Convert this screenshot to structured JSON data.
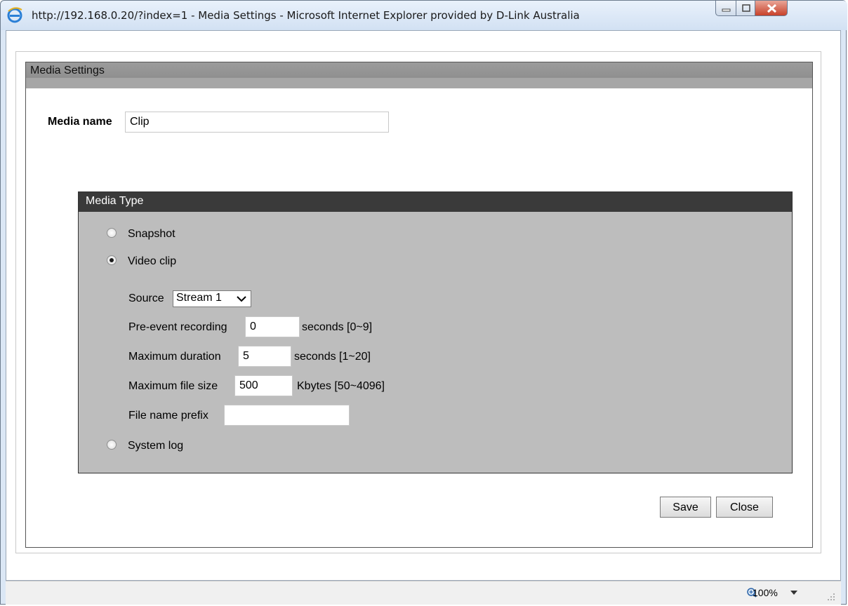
{
  "window": {
    "title": "http://192.168.0.20/?index=1 - Media Settings - Microsoft Internet Explorer provided by D-Link Australia"
  },
  "panel": {
    "title": "Media Settings"
  },
  "media_name": {
    "label": "Media name",
    "value": "Clip"
  },
  "media_type": {
    "title": "Media Type",
    "options": [
      {
        "label": "Snapshot",
        "selected": false
      },
      {
        "label": "Video clip",
        "selected": true
      },
      {
        "label": "System log",
        "selected": false
      }
    ],
    "source": {
      "label": "Source",
      "value": "Stream 1"
    },
    "pre_event": {
      "label": "Pre-event recording",
      "value": "0",
      "unit": "seconds [0~9]"
    },
    "max_duration": {
      "label": "Maximum duration",
      "value": "5",
      "unit": "seconds [1~20]"
    },
    "max_file_size": {
      "label": "Maximum file size",
      "value": "500",
      "unit": "Kbytes [50~4096]"
    },
    "file_prefix": {
      "label": "File name prefix",
      "value": ""
    }
  },
  "actions": {
    "save": "Save",
    "close": "Close"
  },
  "status": {
    "zoom": "100%"
  }
}
